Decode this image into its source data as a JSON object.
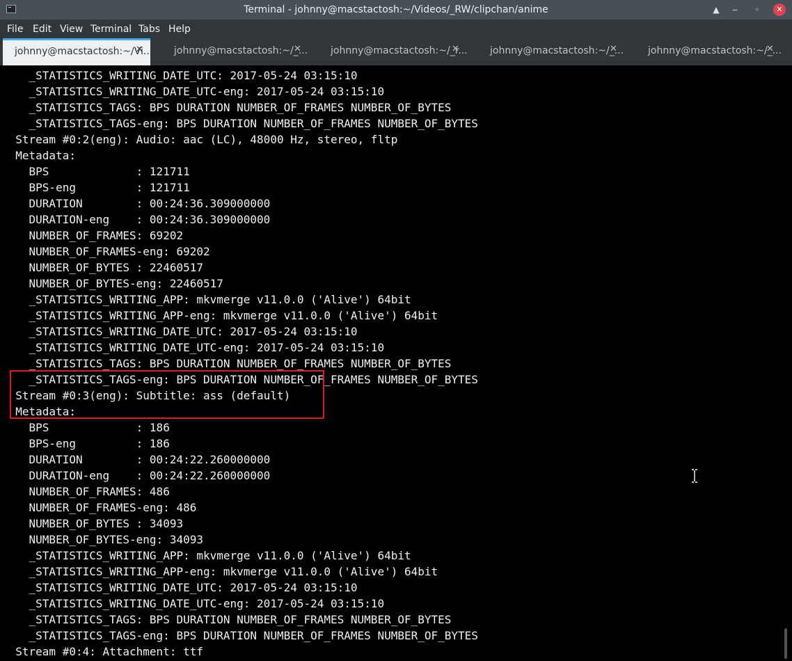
{
  "window": {
    "title": "Terminal - johnny@macstactosh:~/Videos/_RW/clipchan/anime",
    "controls": {
      "keep_above": "▲",
      "minimize": "‒",
      "maximize": "◦",
      "close": "✕"
    }
  },
  "menu": [
    "File",
    "Edit",
    "View",
    "Terminal",
    "Tabs",
    "Help"
  ],
  "tabs": [
    {
      "label": "johnny@macstactosh:~/Vi...",
      "active": true,
      "close": "✕"
    },
    {
      "label": "johnny@macstactosh:~/_...",
      "active": false,
      "close": "✕"
    },
    {
      "label": "johnny@macstactosh:~/_r...",
      "active": false,
      "close": "✕"
    },
    {
      "label": "johnny@macstactosh:~/_...",
      "active": false,
      "close": "✕"
    },
    {
      "label": "johnny@macstactosh:~/_...",
      "active": false,
      "close": "✕"
    }
  ],
  "terminal": {
    "lines": [
      "    _STATISTICS_WRITING_DATE_UTC: 2017-05-24 03:15:10",
      "    _STATISTICS_WRITING_DATE_UTC-eng: 2017-05-24 03:15:10",
      "    _STATISTICS_TAGS: BPS DURATION NUMBER_OF_FRAMES NUMBER_OF_BYTES",
      "    _STATISTICS_TAGS-eng: BPS DURATION NUMBER_OF_FRAMES NUMBER_OF_BYTES",
      "  Stream #0:2(eng): Audio: aac (LC), 48000 Hz, stereo, fltp",
      "  Metadata:",
      "    BPS             : 121711",
      "    BPS-eng         : 121711",
      "    DURATION        : 00:24:36.309000000",
      "    DURATION-eng    : 00:24:36.309000000",
      "    NUMBER_OF_FRAMES: 69202",
      "    NUMBER_OF_FRAMES-eng: 69202",
      "    NUMBER_OF_BYTES : 22460517",
      "    NUMBER_OF_BYTES-eng: 22460517",
      "    _STATISTICS_WRITING_APP: mkvmerge v11.0.0 ('Alive') 64bit",
      "    _STATISTICS_WRITING_APP-eng: mkvmerge v11.0.0 ('Alive') 64bit",
      "    _STATISTICS_WRITING_DATE_UTC: 2017-05-24 03:15:10",
      "    _STATISTICS_WRITING_DATE_UTC-eng: 2017-05-24 03:15:10",
      "    _STATISTICS_TAGS: BPS DURATION NUMBER_OF_FRAMES NUMBER_OF_BYTES",
      "    _STATISTICS_TAGS-eng: BPS DURATION NUMBER_OF_FRAMES NUMBER_OF_BYTES",
      "  Stream #0:3(eng): Subtitle: ass (default)",
      "  Metadata:",
      "    BPS             : 186",
      "    BPS-eng         : 186",
      "    DURATION        : 00:24:22.260000000",
      "    DURATION-eng    : 00:24:22.260000000",
      "    NUMBER_OF_FRAMES: 486",
      "    NUMBER_OF_FRAMES-eng: 486",
      "    NUMBER_OF_BYTES : 34093",
      "    NUMBER_OF_BYTES-eng: 34093",
      "    _STATISTICS_WRITING_APP: mkvmerge v11.0.0 ('Alive') 64bit",
      "    _STATISTICS_WRITING_APP-eng: mkvmerge v11.0.0 ('Alive') 64bit",
      "    _STATISTICS_WRITING_DATE_UTC: 2017-05-24 03:15:10",
      "    _STATISTICS_WRITING_DATE_UTC-eng: 2017-05-24 03:15:10",
      "    _STATISTICS_TAGS: BPS DURATION NUMBER_OF_FRAMES NUMBER_OF_BYTES",
      "    _STATISTICS_TAGS-eng: BPS DURATION NUMBER_OF_FRAMES NUMBER_OF_BYTES",
      "  Stream #0:4: Attachment: ttf"
    ]
  },
  "colors": {
    "terminal_bg": "#000000",
    "terminal_fg": "#f0f0f0",
    "highlight_border": "#e4191c",
    "active_tab_accent": "#3daee9",
    "close_button": "#da4453"
  },
  "cursor_icon": "ibeam-cursor-icon",
  "scrollbar": {
    "position_fraction": 1.0
  }
}
